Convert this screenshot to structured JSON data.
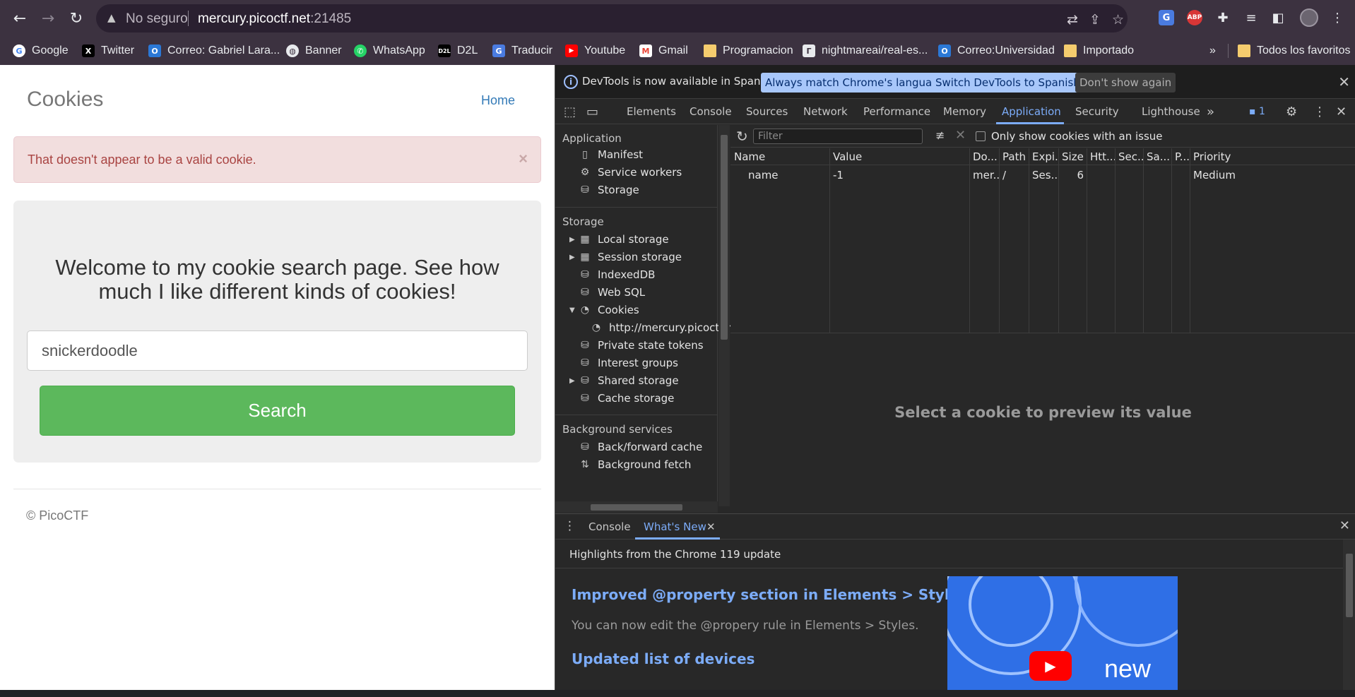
{
  "browser": {
    "security_label": "No seguro",
    "host": "mercury.picoctf.net",
    "port": ":21485",
    "bookmarks": [
      {
        "label": "Google",
        "icon": "google-icon"
      },
      {
        "label": "Twitter",
        "icon": "x-icon"
      },
      {
        "label": "Correo: Gabriel Lara...",
        "icon": "outlook-icon"
      },
      {
        "label": "Banner",
        "icon": "globe-icon"
      },
      {
        "label": "WhatsApp",
        "icon": "whatsapp-icon"
      },
      {
        "label": "D2L",
        "icon": "d2l-icon"
      },
      {
        "label": "Traducir",
        "icon": "translate-icon"
      },
      {
        "label": "Youtube",
        "icon": "youtube-icon"
      },
      {
        "label": "Gmail",
        "icon": "gmail-icon"
      },
      {
        "label": "Programacion",
        "icon": "folder-icon"
      },
      {
        "label": "nightmareai/real-es...",
        "icon": "replicate-icon"
      },
      {
        "label": "Correo:Universidad",
        "icon": "outlook-icon"
      },
      {
        "label": "Importado",
        "icon": "folder-icon"
      }
    ],
    "overflow_chevron": "»",
    "all_bookmarks": "Todos los favoritos"
  },
  "page": {
    "brand": "Cookies",
    "nav_home": "Home",
    "alert_text": "That doesn't appear to be a valid cookie.",
    "alert_close": "×",
    "welcome_text": "Welcome to my cookie search page. See how much I like different kinds of cookies!",
    "search_value": "snickerdoodle",
    "search_button": "Search",
    "footer": "© PicoCTF"
  },
  "devtools": {
    "infobar": {
      "text": "DevTools is now available in Spanish!",
      "btn_match": "Always match Chrome's language",
      "btn_switch": "Switch DevTools to Spanish",
      "btn_dismiss": "Don't show again"
    },
    "tabs": [
      "Elements",
      "Console",
      "Sources",
      "Network",
      "Performance",
      "Memory",
      "Application",
      "Security",
      "Lighthouse"
    ],
    "active_tab": "Application",
    "issues_count": "1",
    "sidebar": {
      "application_header": "Application",
      "application_items": [
        "Manifest",
        "Service workers",
        "Storage"
      ],
      "storage_header": "Storage",
      "storage_items": [
        "Local storage",
        "Session storage",
        "IndexedDB",
        "Web SQL",
        "Cookies",
        "http://mercury.picoctf.n",
        "Private state tokens",
        "Interest groups",
        "Shared storage",
        "Cache storage"
      ],
      "background_header": "Background services",
      "background_items": [
        "Back/forward cache",
        "Background fetch"
      ]
    },
    "cookies": {
      "filter_placeholder": "Filter",
      "only_issues_label": "Only show cookies with an issue",
      "columns": [
        "Name",
        "Value",
        "Do...",
        "Path",
        "Expi...",
        "Size",
        "Htt...",
        "Sec...",
        "Sa...",
        "P...",
        "Priority"
      ],
      "rows": [
        [
          "name",
          "-1",
          "mer...",
          "/",
          "Ses...",
          "6",
          "",
          "",
          "",
          "",
          "Medium"
        ]
      ],
      "preview_message": "Select a cookie to preview its value"
    },
    "drawer": {
      "tabs": [
        "Console",
        "What's New"
      ],
      "active_tab": "What's New",
      "highlights": "Highlights from the Chrome 119 update",
      "heading1": "Improved @property section in Elements > Styles",
      "para1": "You can now edit the @propery rule in Elements > Styles.",
      "heading2": "Updated list of devices",
      "video_label": "new"
    }
  },
  "colors": {
    "chrome_bg": "#3c3240",
    "devtools_bg": "#282828",
    "accent_blue": "#7cacf8",
    "alert_bg": "#f2dede",
    "alert_text": "#a94442",
    "search_green": "#5cb85c"
  }
}
